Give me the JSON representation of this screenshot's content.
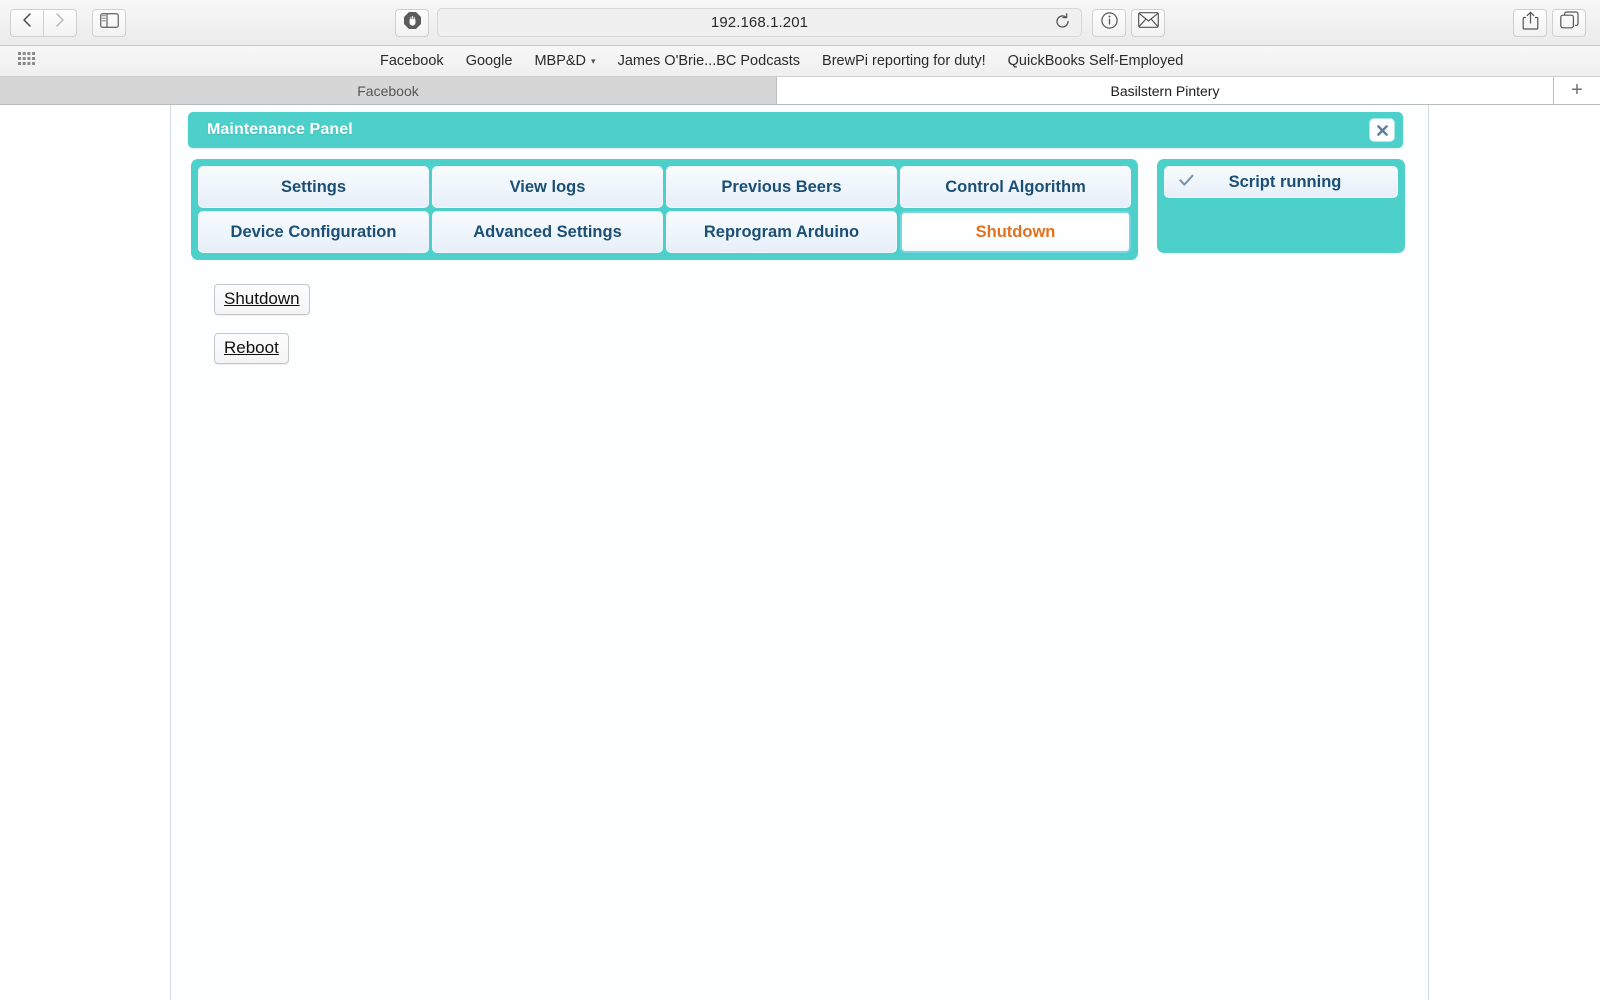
{
  "browser": {
    "back_icon": "chevron-left-icon",
    "forward_icon": "chevron-right-icon",
    "sidebar_icon": "sidebar-toggle-icon",
    "shield_icon": "adblock-shield-icon",
    "url": "192.168.1.201",
    "reload_icon": "reload-icon",
    "info_icon": "info-circle-icon",
    "mail_icon": "mail-envelope-icon",
    "share_icon": "share-upload-icon",
    "tabs_overview_icon": "tab-overview-icon",
    "bookmarks_grid_icon": "bookmarks-grid-icon",
    "bookmarks": [
      {
        "label": "Facebook",
        "has_caret": false
      },
      {
        "label": "Google",
        "has_caret": false
      },
      {
        "label": "MBP&D",
        "has_caret": true
      },
      {
        "label": "James O'Brie...BC Podcasts",
        "has_caret": false
      },
      {
        "label": "BrewPi reporting for duty!",
        "has_caret": false
      },
      {
        "label": "QuickBooks Self-Employed",
        "has_caret": false
      }
    ],
    "tabs": [
      {
        "label": "Facebook",
        "active": false
      },
      {
        "label": "Basilstern Pintery",
        "active": true
      }
    ],
    "new_tab_label": "+"
  },
  "panel": {
    "title": "Maintenance Panel",
    "close_icon": "close-x-icon",
    "accent_color": "#4dd0ca",
    "nav_buttons": [
      {
        "label": "Settings",
        "active": false
      },
      {
        "label": "View logs",
        "active": false
      },
      {
        "label": "Previous Beers",
        "active": false
      },
      {
        "label": "Control Algorithm",
        "active": false
      },
      {
        "label": "Device Configuration",
        "active": false
      },
      {
        "label": "Advanced Settings",
        "active": false
      },
      {
        "label": "Reprogram Arduino",
        "active": false
      },
      {
        "label": "Shutdown",
        "active": true
      }
    ],
    "status": {
      "check_icon": "check-mark-icon",
      "label": "Script running"
    },
    "actions": [
      {
        "label": "Shutdown"
      },
      {
        "label": "Reboot"
      }
    ]
  }
}
